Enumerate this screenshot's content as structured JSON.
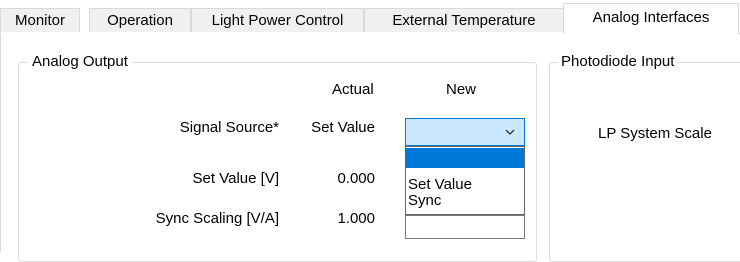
{
  "tabs": [
    {
      "label": "Monitor"
    },
    {
      "label": "Operation"
    },
    {
      "label": "Light Power Control"
    },
    {
      "label": "External Temperature"
    },
    {
      "label": "Analog Interfaces",
      "active": true
    }
  ],
  "analog_output": {
    "title": "Analog Output",
    "col_actual": "Actual",
    "col_new": "New",
    "rows": [
      {
        "label": "Signal Source*",
        "actual": "Set Value"
      },
      {
        "label": "Set Value [V]",
        "actual": "0.000"
      },
      {
        "label": "Sync Scaling [V/A]",
        "actual": "1.000"
      }
    ],
    "signal_source_dropdown": {
      "selected": "",
      "options": [
        "",
        "Set Value",
        "Sync"
      ]
    }
  },
  "photodiode_input": {
    "title": "Photodiode Input",
    "lp_system_scale_label": "LP System Scale"
  }
}
